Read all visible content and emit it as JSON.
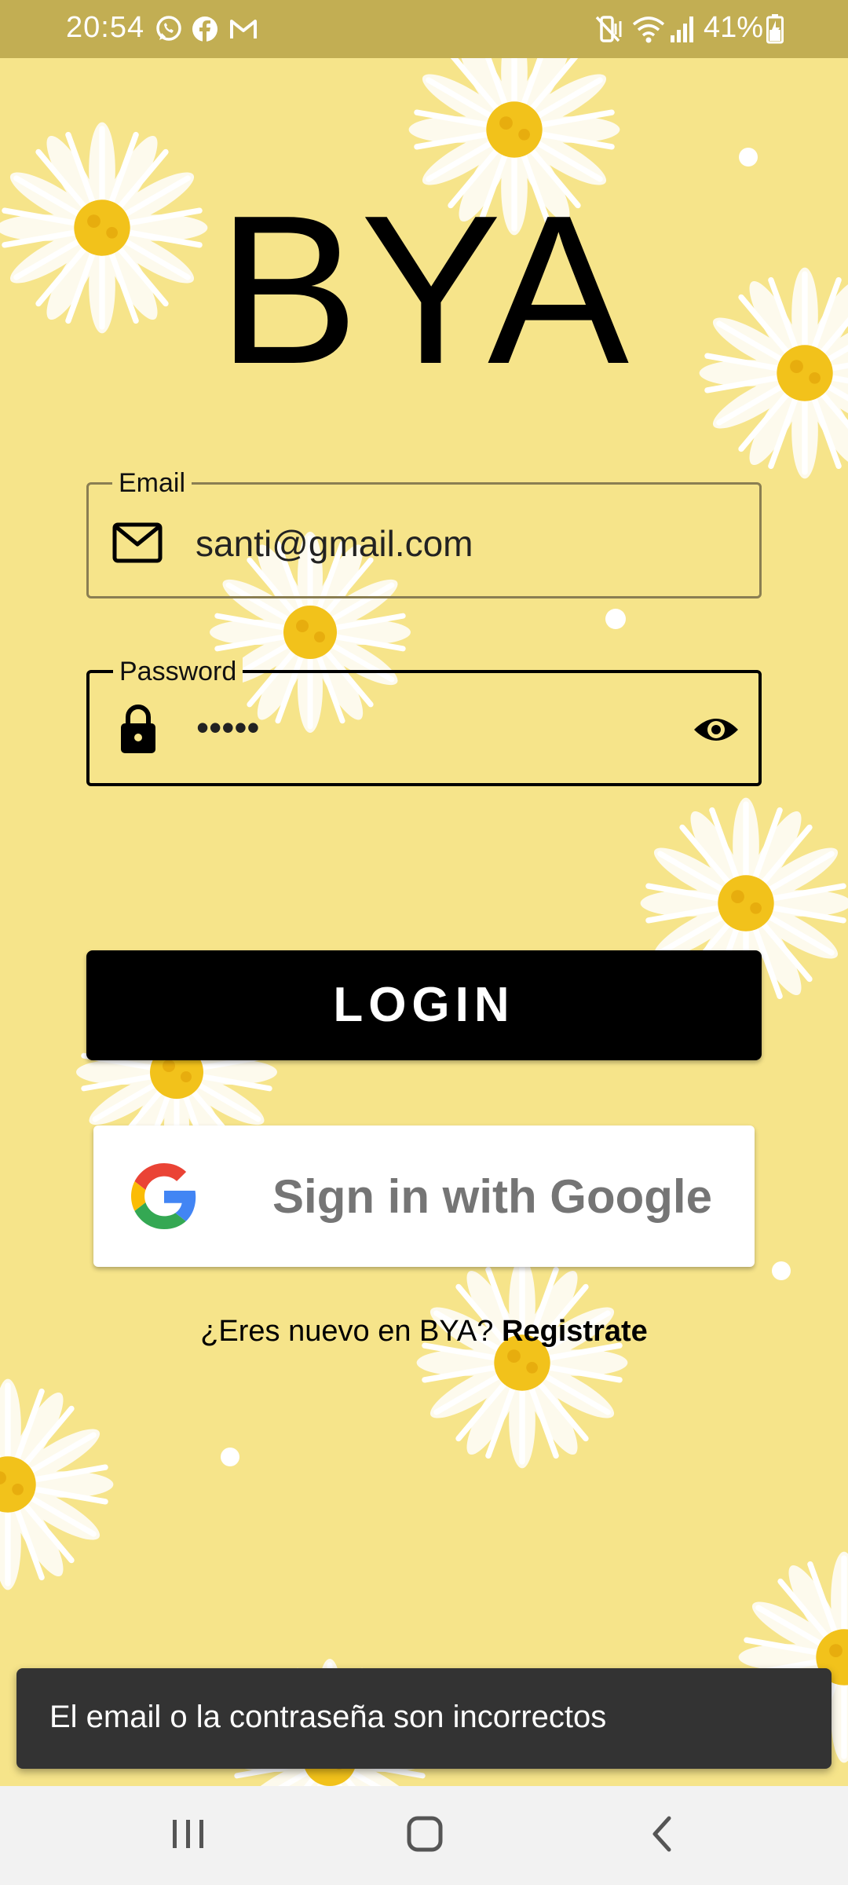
{
  "status_bar": {
    "time": "20:54",
    "battery": "41%",
    "icons": [
      "whatsapp-icon",
      "facebook-icon",
      "gmail-icon",
      "mute-icon",
      "wifi-icon",
      "signal-icon",
      "battery-icon"
    ]
  },
  "app": {
    "title": "BYA"
  },
  "email": {
    "label": "Email",
    "value": "santi@gmail.com",
    "icon": "mail-icon"
  },
  "password": {
    "label": "Password",
    "value": "•••••",
    "icon": "lock-icon",
    "toggle_icon": "eye-icon"
  },
  "login": {
    "label": "LOGIN"
  },
  "google": {
    "label": "Sign in with Google",
    "icon": "google-logo-icon"
  },
  "register": {
    "prompt": "¿Eres nuevo en BYA? ",
    "link": "Registrate"
  },
  "snackbar": {
    "message": "El email o la contraseña son incorrectos"
  },
  "navigation": {
    "icons": [
      "recent-apps-icon",
      "home-icon",
      "back-icon"
    ]
  },
  "colors": {
    "background": "#f6e48a",
    "status_bar": "#c2ae53",
    "login_button": "#000000",
    "snackbar": "#333333",
    "daisy_center": "#f2c21b"
  }
}
